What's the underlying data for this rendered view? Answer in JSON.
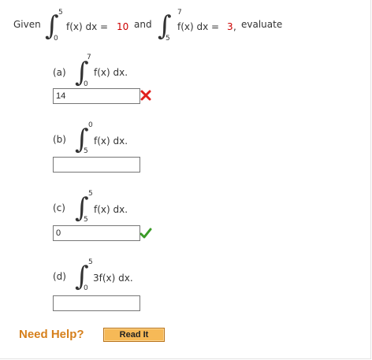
{
  "question": {
    "given_label": "Given",
    "integral1": {
      "upper": "5",
      "lower": "0",
      "integrand": "f(x) dx =",
      "value": "10"
    },
    "and_label": "and",
    "integral2": {
      "upper": "7",
      "lower": "5",
      "integrand": "f(x) dx =",
      "value": "3",
      "trailing": ","
    },
    "evaluate_label": "evaluate"
  },
  "parts": [
    {
      "label": "(a)",
      "upper": "7",
      "lower": "0",
      "integrand": "f(x) dx.",
      "answer": "14",
      "status": "incorrect",
      "status_icon": "cross-icon",
      "status_color": "#e0201c"
    },
    {
      "label": "(b)",
      "upper": "0",
      "lower": "5",
      "integrand": "f(x) dx.",
      "answer": "",
      "status": "",
      "status_icon": "",
      "status_color": ""
    },
    {
      "label": "(c)",
      "upper": "5",
      "lower": "5",
      "integrand": "f(x) dx.",
      "answer": "0",
      "status": "correct",
      "status_icon": "check-icon",
      "status_color": "#3a9b27"
    },
    {
      "label": "(d)",
      "upper": "5",
      "lower": "0",
      "integrand": "3f(x) dx.",
      "answer": "",
      "status": "",
      "status_icon": "",
      "status_color": ""
    }
  ],
  "help": {
    "need_help_label": "Need Help?",
    "read_it_label": "Read It"
  },
  "colors": {
    "value_red": "#cc0000",
    "help_orange": "#d6801c",
    "button_orange": "#f6b957"
  }
}
